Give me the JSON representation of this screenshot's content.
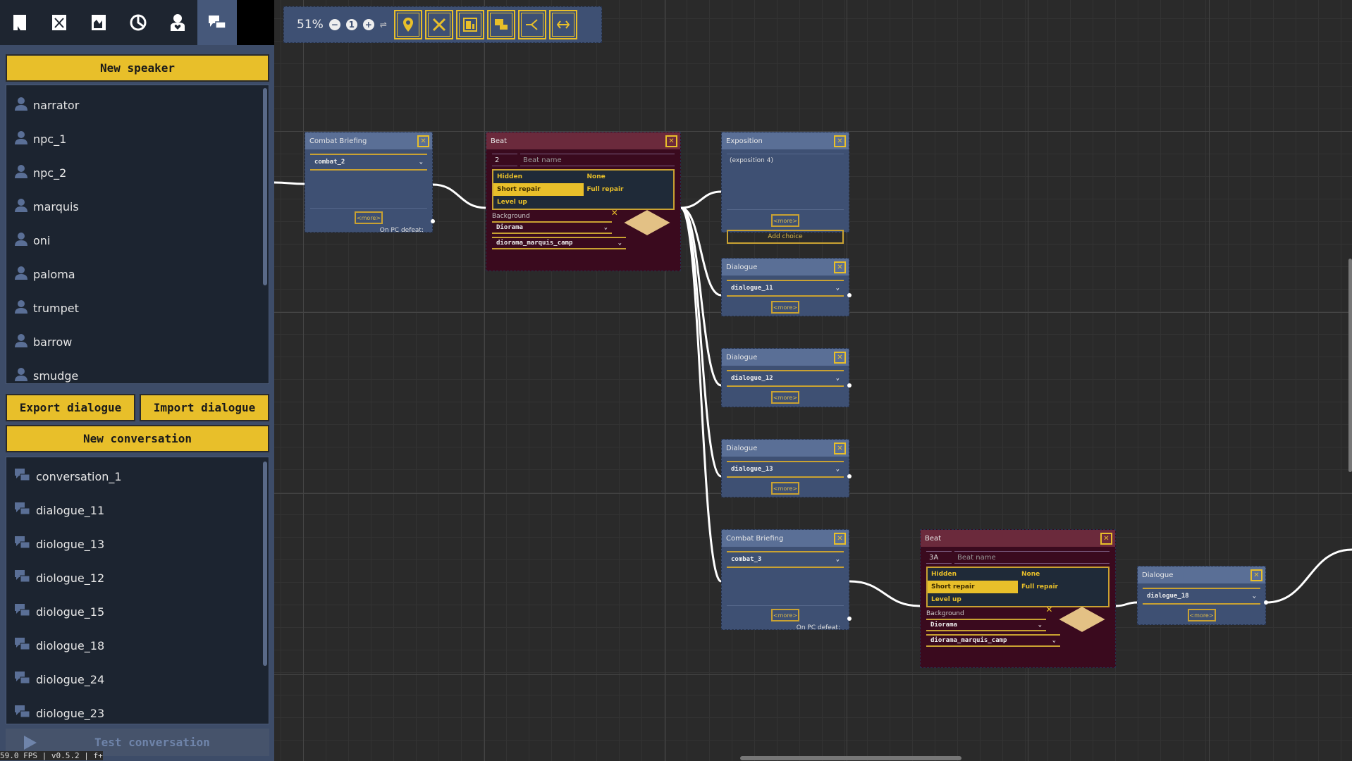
{
  "tabs": [
    "notes-icon",
    "combat-card-icon",
    "scene-card-icon",
    "clock-icon",
    "person-heart-icon",
    "conversations-icon"
  ],
  "left": {
    "new_speaker": "New speaker",
    "speakers": [
      "narrator",
      "npc_1",
      "npc_2",
      "marquis",
      "oni",
      "paloma",
      "trumpet",
      "barrow",
      "smudge"
    ],
    "export": "Export dialogue",
    "import": "Import dialogue",
    "new_conversation": "New conversation",
    "conversations": [
      "conversation_1",
      "dialogue_11",
      "diologue_13",
      "diologue_12",
      "diologue_15",
      "diologue_18",
      "diologue_24",
      "diologue_23"
    ],
    "test": "Test conversation"
  },
  "status": "59.0 FPS | v0.5.2 | f+",
  "toolbar": {
    "zoom": "51%",
    "minus": "−",
    "reset": "1",
    "plus": "+",
    "buttons": [
      "location-pin-icon",
      "combat-icon",
      "panel-icon",
      "dialogue-icon",
      "branch-icon",
      "link-icon"
    ]
  },
  "colors": {
    "accent": "#e8bf2a",
    "node": "#3e5073",
    "beat": "#3a0a1e"
  },
  "nodes": [
    {
      "type": "combat",
      "title": "Combat Briefing",
      "select": "combat_2",
      "more": "<more>",
      "defeat": "On PC defeat:"
    },
    {
      "type": "beat",
      "title": "Beat",
      "number": "2",
      "name_placeholder": "Beat name",
      "options": [
        "Hidden",
        "None",
        "Short repair",
        "Full repair",
        "Level up"
      ],
      "selected": "Short repair",
      "bg_label": "Background",
      "bg_type": "Diorama",
      "bg_value": "diorama_marquis_camp"
    },
    {
      "type": "exposition",
      "title": "Exposition",
      "text": "(exposition 4)",
      "more": "<more>",
      "add_choice": "Add choice"
    },
    {
      "type": "dialogue",
      "title": "Dialogue",
      "select": "dialogue_11",
      "more": "<more>"
    },
    {
      "type": "dialogue",
      "title": "Dialogue",
      "select": "dialogue_12",
      "more": "<more>"
    },
    {
      "type": "dialogue",
      "title": "Dialogue",
      "select": "dialogue_13",
      "more": "<more>"
    },
    {
      "type": "combat",
      "title": "Combat Briefing",
      "select": "combat_3",
      "more": "<more>",
      "defeat": "On PC defeat:"
    },
    {
      "type": "beat",
      "title": "Beat",
      "number": "3A",
      "name_placeholder": "Beat name",
      "options": [
        "Hidden",
        "None",
        "Short repair",
        "Full repair",
        "Level up"
      ],
      "selected": "Short repair",
      "bg_label": "Background",
      "bg_type": "Diorama",
      "bg_value": "diorama_marquis_camp"
    },
    {
      "type": "dialogue",
      "title": "Dialogue",
      "select": "dialogue_18",
      "more": "<more>"
    }
  ]
}
